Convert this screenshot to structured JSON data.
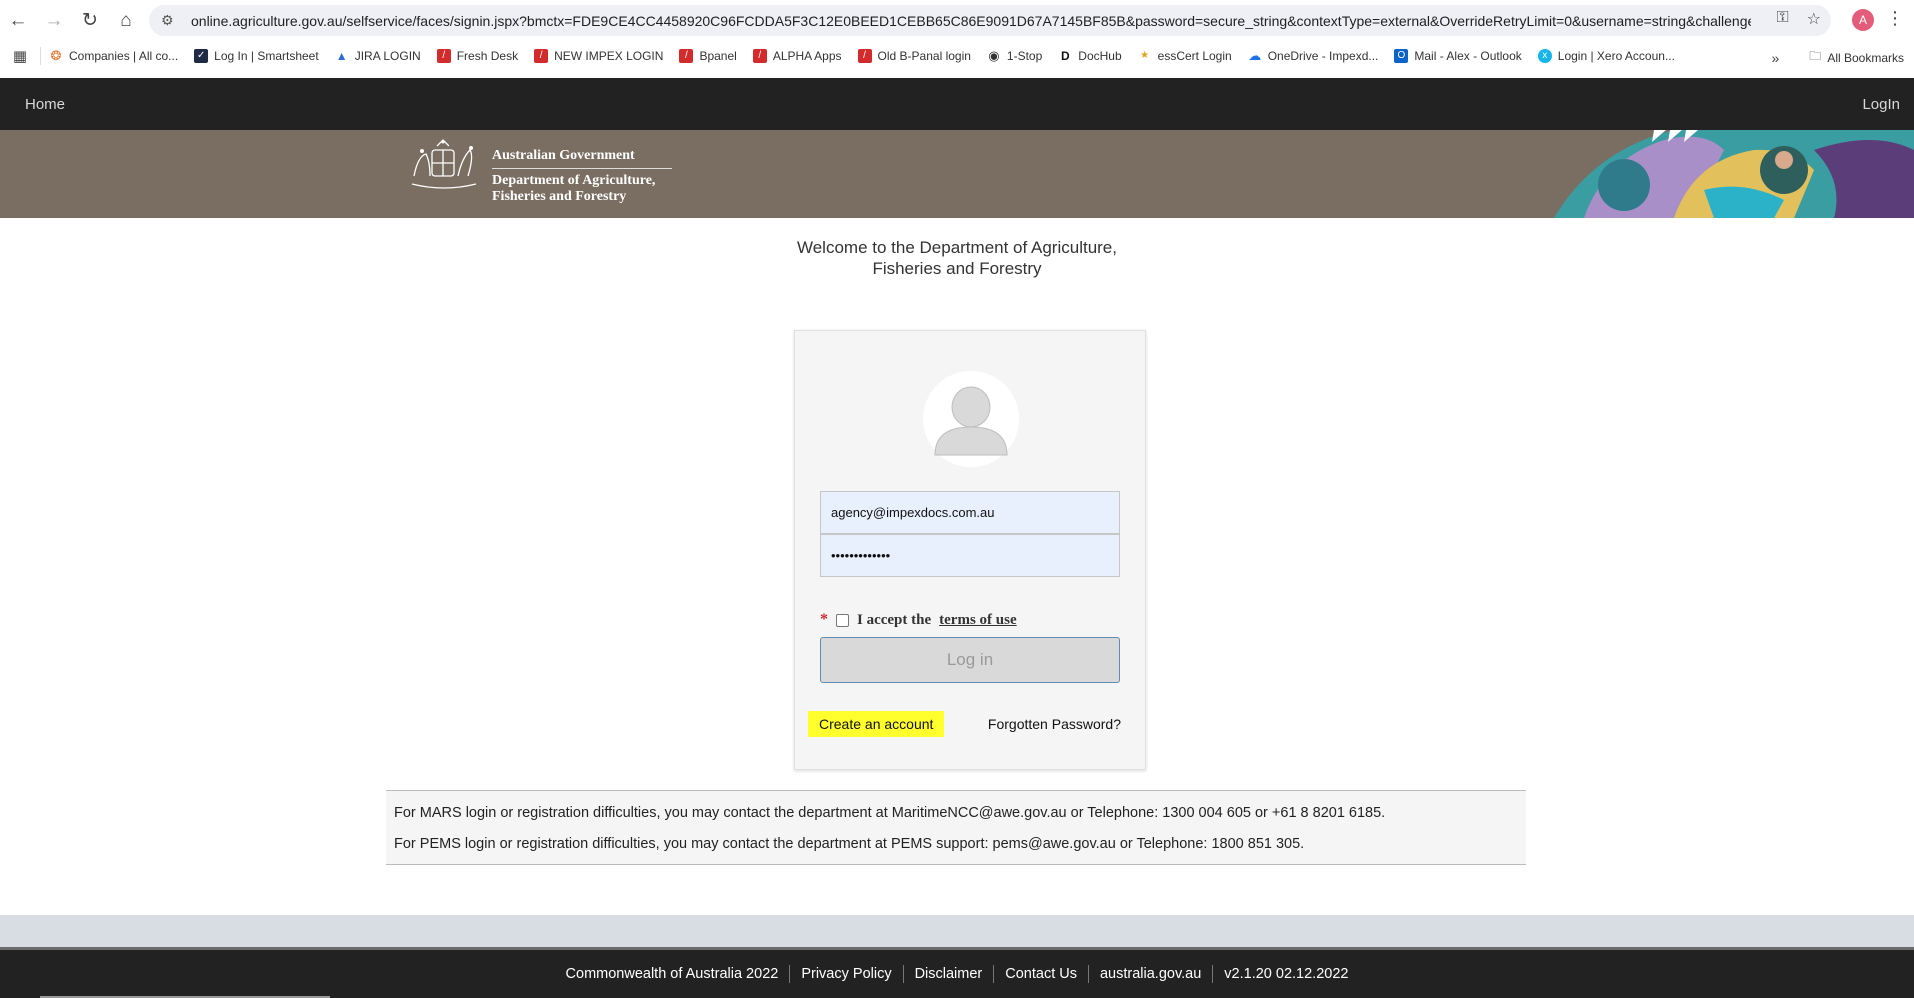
{
  "browser": {
    "url": "online.agriculture.gov.au/selfservice/faces/signin.jspx?bmctx=FDE9CE4CC4458920C96FCDDA5F3C12E0BEED1CEBB65C86E9091D67A7145BF85B&password=secure_string&contextType=external&OverrideRetryLimit=0&username=string&challenge_url=...",
    "profile_initial": "A",
    "bookmarks": [
      {
        "label": "Companies | All co...",
        "icon": "hubspot-icon"
      },
      {
        "label": "Log In | Smartsheet",
        "icon": "smartsheet-icon"
      },
      {
        "label": "JIRA LOGIN",
        "icon": "jira-icon"
      },
      {
        "label": "Fresh Desk",
        "icon": "red-slash-icon"
      },
      {
        "label": "NEW IMPEX LOGIN",
        "icon": "red-slash-icon"
      },
      {
        "label": "Bpanel",
        "icon": "red-slash-icon"
      },
      {
        "label": "ALPHA Apps",
        "icon": "red-slash-icon"
      },
      {
        "label": "Old B-Panal login",
        "icon": "red-slash-icon"
      },
      {
        "label": "1-Stop",
        "icon": "globe-icon"
      },
      {
        "label": "DocHub",
        "icon": "dochub-icon"
      },
      {
        "label": "essCert Login",
        "icon": "esscert-icon"
      },
      {
        "label": "OneDrive - Impexd...",
        "icon": "onedrive-icon"
      },
      {
        "label": "Mail - Alex - Outlook",
        "icon": "outlook-icon"
      },
      {
        "label": "Login | Xero Accoun...",
        "icon": "xero-icon"
      }
    ],
    "all_bookmarks": "All Bookmarks"
  },
  "nav": {
    "home": "Home",
    "login": "LogIn"
  },
  "banner": {
    "line1": "Australian Government",
    "line2": "Department of Agriculture,",
    "line3": "Fisheries and Forestry"
  },
  "welcome": {
    "line1": "Welcome to the Department of Agriculture,",
    "line2": "Fisheries and Forestry"
  },
  "login": {
    "username": "agency@impexdocs.com.au",
    "password": "•••••••••••••",
    "terms_prefix": "I accept the",
    "terms_link": "terms of use",
    "button": "Log in",
    "create_account": "Create an account",
    "forgot": "Forgotten Password?"
  },
  "notice": {
    "mars": "For MARS login or registration difficulties, you may contact the department at MaritimeNCC@awe.gov.au or Telephone: 1300 004 605 or +61 8 8201 6185.",
    "pems": "For PEMS login or registration difficulties, you may contact the department at PEMS support: pems@awe.gov.au or Telephone: 1800 851 305."
  },
  "footer": {
    "items": [
      "Commonwealth of Australia 2022",
      "Privacy Policy",
      "Disclaimer",
      "Contact Us",
      "australia.gov.au",
      "v2.1.20 02.12.2022"
    ]
  },
  "colors": {
    "nav_bg": "#222222",
    "banner_bg": "#7a6d61",
    "highlight": "#ffff2e"
  }
}
